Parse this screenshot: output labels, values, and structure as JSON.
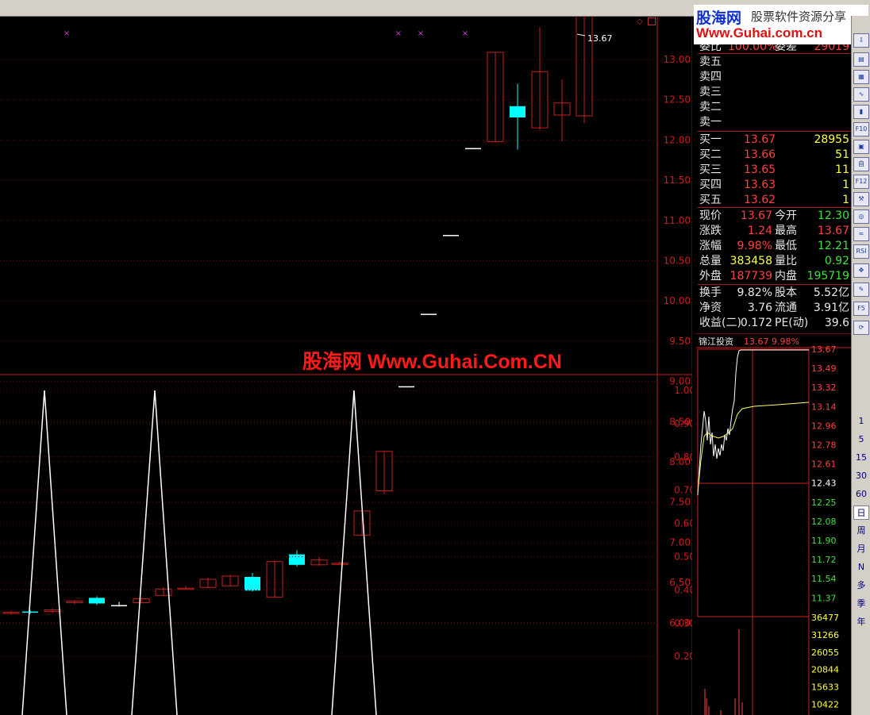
{
  "watermark": {
    "logo_text": "股海网",
    "tagline": "股票软件资源分享",
    "url": "Www.Guhai.com.cn",
    "center_text": "股海网 Www.Guhai.Com.CN"
  },
  "main_chart": {
    "last_price_label": "13.67",
    "y_ticks": [
      "13.00",
      "12.50",
      "12.00",
      "11.50",
      "11.00",
      "10.50",
      "10.00",
      "9.50",
      "9.00",
      "8.50",
      "8.00",
      "7.50",
      "7.00",
      "6.50",
      "6.00"
    ],
    "marker_glyph": "×",
    "up_color": "#ff4040",
    "down_color": "#00ffff"
  },
  "indicator": {
    "y_ticks": [
      "1.00",
      "0.90",
      "0.80",
      "0.70",
      "0.60",
      "0.50",
      "0.40",
      "0.30",
      "0.20"
    ]
  },
  "quote_panel": {
    "ratio_label": "委比",
    "ratio_value": "100.00%",
    "diff_label": "委差",
    "diff_value": "29019",
    "sell_levels": [
      "卖五",
      "卖四",
      "卖三",
      "卖二",
      "卖一"
    ],
    "buy_levels": [
      {
        "label": "买一",
        "price": "13.67",
        "vol": "28955"
      },
      {
        "label": "买二",
        "price": "13.66",
        "vol": "51"
      },
      {
        "label": "买三",
        "price": "13.65",
        "vol": "11"
      },
      {
        "label": "买四",
        "price": "13.63",
        "vol": "1"
      },
      {
        "label": "买五",
        "price": "13.62",
        "vol": "1"
      }
    ],
    "stats": [
      {
        "l1": "现价",
        "v1": "13.67",
        "l2": "今开",
        "v2": "12.30"
      },
      {
        "l1": "涨跌",
        "v1": "1.24",
        "l2": "最高",
        "v2": "13.67"
      },
      {
        "l1": "涨幅",
        "v1": "9.98%",
        "l2": "最低",
        "v2": "12.21"
      },
      {
        "l1": "总量",
        "v1": "383458",
        "l2": "量比",
        "v2": "0.92"
      },
      {
        "l1": "外盘",
        "v1": "187739",
        "l2": "内盘",
        "v2": "195719"
      }
    ],
    "stats2": [
      {
        "l1": "换手",
        "v1": "9.82%",
        "l2": "股本",
        "v2": "5.52亿"
      },
      {
        "l1": "净资",
        "v1": "3.76",
        "l2": "流通",
        "v2": "3.91亿"
      },
      {
        "l1": "收益(二)",
        "v1": "0.172",
        "l2": "PE(动)",
        "v2": "39.6"
      }
    ]
  },
  "intraday": {
    "stock_name": "锦江投资",
    "price": "13.67",
    "pct": "9.98%",
    "price_ticks": [
      "13.67",
      "13.49",
      "13.32",
      "13.14",
      "12.96",
      "12.78",
      "12.61",
      "12.43",
      "12.25",
      "12.08",
      "11.90",
      "11.72",
      "11.54",
      "11.37"
    ],
    "volume_ticks": [
      "36477",
      "31266",
      "26055",
      "20844",
      "15633",
      "10422"
    ]
  },
  "toolbar": {
    "icons": [
      "arrow-down",
      "doc",
      "table",
      "line",
      "candle",
      "f10",
      "cube",
      "self",
      "f12",
      "tools",
      "info",
      "wave",
      "rsi",
      "move",
      "pen",
      "f5",
      "refresh"
    ],
    "periods": [
      "1",
      "5",
      "15",
      "30",
      "60",
      "日",
      "周",
      "月",
      "N",
      "多",
      "季",
      "年"
    ],
    "selected_period": "日"
  }
}
